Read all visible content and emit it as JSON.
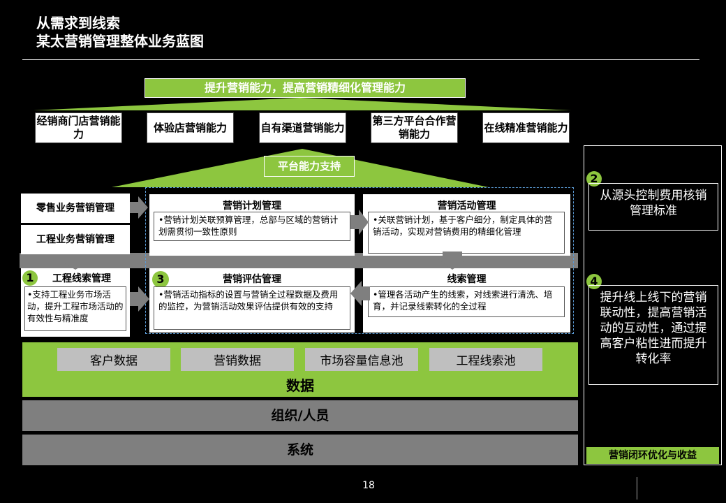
{
  "header": {
    "title_line1": "从需求到线索",
    "title_line2": "某太营销管理整体业务蓝图"
  },
  "top_banner": "提升营销能力，提高营销精细化管理能力",
  "capabilities": [
    "经销商门店营销能力",
    "体验店营销能力",
    "自有渠道营销能力",
    "第三方平台合作营销能力",
    "在线精准营销能力"
  ],
  "platform_label": "平台能力支持",
  "left_labels": {
    "retail": "零售业务营销管理",
    "engineering": "工程业务营销管理"
  },
  "lead_panel": {
    "num": "1",
    "title": "工程线索管理",
    "body": "•支持工程业务市场活动，提升工程市场活动的有效性与精准度"
  },
  "plan_panel": {
    "title": "营销计划管理",
    "body": "•营销计划关联预算管理，总部与区域的营销计划需贯彻一致性原则"
  },
  "activity_panel": {
    "title": "营销活动管理",
    "body": "•关联营销计划，基于客户细分，制定具体的营销活动，实现对营销费用的精细化管理"
  },
  "eval_panel": {
    "num": "3",
    "title": "营销评估管理",
    "body": "•营销活动指标的设置与营销全过程数据及费用的监控，为营销活动效果评估提供有效的支持"
  },
  "clue_panel": {
    "title": "线索管理",
    "body": "•管理各活动产生的线索，对线索进行清洗、培育，并记录线索转化的全过程"
  },
  "data_pools": [
    "客户数据",
    "营销数据",
    "市场容量信息池",
    "工程线索池"
  ],
  "layers": {
    "data": "数据",
    "org": "组织/人员",
    "system": "系统"
  },
  "right": {
    "num2": "2",
    "text2": "从源头控制费用核销管理标准",
    "num4": "4",
    "text4": "提升线上线下的营销联动性，提高营销活动的互动性，通过提高客户粘性进而提升转化率",
    "footer": "营销闭环优化与收益"
  },
  "page_number": "18",
  "colors": {
    "accent": "#8dc63f",
    "grey": "#7f7f7f",
    "pool": "#bfbfbf"
  }
}
